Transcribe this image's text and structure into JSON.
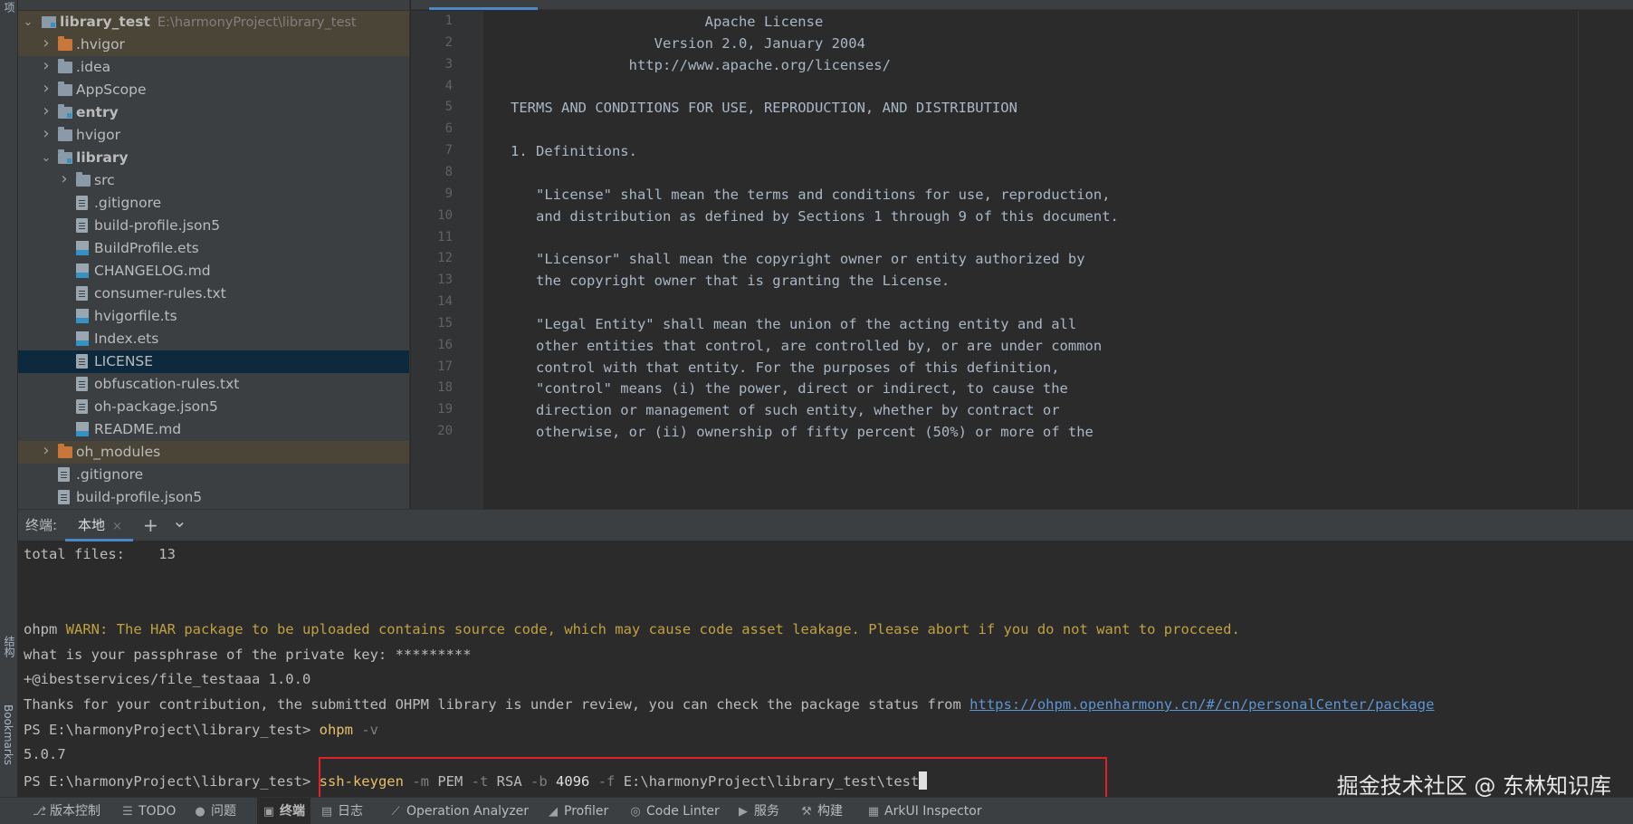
{
  "left_strip": {
    "top_label": "项",
    "structure_label": "结构",
    "bookmarks_label": "Bookmarks"
  },
  "project": {
    "root": {
      "label": "library_test",
      "path": "E:\\harmonyProject\\library_test"
    },
    "items": [
      {
        "label": ".hvigor",
        "icon": "folder-orange",
        "arrow": "right"
      },
      {
        "label": ".idea",
        "icon": "folder",
        "arrow": "right"
      },
      {
        "label": "AppScope",
        "icon": "folder",
        "arrow": "right"
      },
      {
        "label": "entry",
        "icon": "module",
        "arrow": "right"
      },
      {
        "label": "hvigor",
        "icon": "folder",
        "arrow": "right"
      },
      {
        "label": "library",
        "icon": "module",
        "arrow": "down"
      },
      {
        "label": "src",
        "icon": "folder",
        "arrow": "right"
      },
      {
        "label": ".gitignore",
        "icon": "file"
      },
      {
        "label": "build-profile.json5",
        "icon": "file"
      },
      {
        "label": "BuildProfile.ets",
        "icon": "ets"
      },
      {
        "label": "CHANGELOG.md",
        "icon": "md"
      },
      {
        "label": "consumer-rules.txt",
        "icon": "file"
      },
      {
        "label": "hvigorfile.ts",
        "icon": "ets"
      },
      {
        "label": "Index.ets",
        "icon": "ets"
      },
      {
        "label": "LICENSE",
        "icon": "file"
      },
      {
        "label": "obfuscation-rules.txt",
        "icon": "file"
      },
      {
        "label": "oh-package.json5",
        "icon": "file"
      },
      {
        "label": "README.md",
        "icon": "md"
      },
      {
        "label": "oh_modules",
        "icon": "folder-orange",
        "arrow": "right"
      },
      {
        "label": ".gitignore",
        "icon": "file"
      },
      {
        "label": "build-profile.json5",
        "icon": "file"
      }
    ]
  },
  "editor": {
    "lines": [
      "                          Apache License",
      "                    Version 2.0, January 2004",
      "                 http://www.apache.org/licenses/",
      "",
      "   TERMS AND CONDITIONS FOR USE, REPRODUCTION, AND DISTRIBUTION",
      "",
      "   1. Definitions.",
      "",
      "      \"License\" shall mean the terms and conditions for use, reproduction,",
      "      and distribution as defined by Sections 1 through 9 of this document.",
      "",
      "      \"Licensor\" shall mean the copyright owner or entity authorized by",
      "      the copyright owner that is granting the License.",
      "",
      "      \"Legal Entity\" shall mean the union of the acting entity and all",
      "      other entities that control, are controlled by, or are under common",
      "      control with that entity. For the purposes of this definition,",
      "      \"control\" means (i) the power, direct or indirect, to cause the",
      "      direction or management of such entity, whether by contract or",
      "      otherwise, or (ii) ownership of fifty percent (50%) or more of the"
    ]
  },
  "terminal": {
    "title": "终端:",
    "tab_label": "本地",
    "tab_close": "×",
    "add": "+",
    "menu": "⌄",
    "total_files": "total files:    13",
    "warn_prefix": "ohpm",
    "warn_text": "WARN: The HAR package to be uploaded contains source code, which may cause code asset leakage. Please abort if you do not want to procceed.",
    "passphrase": "what is your passphrase of the private key: *********",
    "published": "+@ibestservices/file_testaaa 1.0.0",
    "thanks_text": "Thanks for your contribution, the submitted OHPM library is under review, you can check the package status from ",
    "thanks_link": "https://ohpm.openharmony.cn/#/cn/personalCenter/package",
    "prompt": "PS E:\\harmonyProject\\library_test>",
    "cmd1_name": "ohpm",
    "cmd1_flag": "-v",
    "version_out": "5.0.7",
    "cmd2": {
      "name": "ssh-keygen",
      "m_flag": "-m",
      "m_val": "PEM",
      "t_flag": "-t",
      "t_val": "RSA",
      "b_flag": "-b",
      "b_val": "4096",
      "f_flag": "-f",
      "f_val": "E:\\harmonyProject\\library_test\\test"
    }
  },
  "watermark": "掘金技术社区 @ 东林知识库",
  "statusbar": [
    {
      "label": "版本控制",
      "icon": "⎇"
    },
    {
      "label": "TODO",
      "icon": "☰"
    },
    {
      "label": "问题",
      "icon": "●"
    },
    {
      "label": "终端",
      "icon": "▣",
      "active": true
    },
    {
      "label": "日志",
      "icon": "▤"
    },
    {
      "label": "Operation Analyzer",
      "icon": "⟋"
    },
    {
      "label": "Profiler",
      "icon": "◢"
    },
    {
      "label": "Code Linter",
      "icon": "◎"
    },
    {
      "label": "服务",
      "icon": "▶"
    },
    {
      "label": "构建",
      "icon": "⚒"
    },
    {
      "label": "ArkUI Inspector",
      "icon": "▦"
    }
  ]
}
